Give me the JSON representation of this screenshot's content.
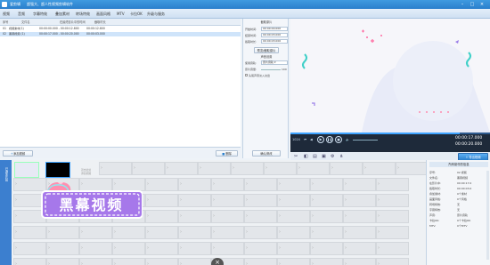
{
  "titlebar": {
    "app_name": "爱剪辑",
    "subtitle": "超强大、超人性视频剪辑软件"
  },
  "menu": [
    "视频",
    "音频",
    "字幕特效",
    "叠加素材",
    "转场特效",
    "画面风格",
    "MTV",
    "卡拉OK",
    "升级与服务"
  ],
  "table": {
    "headers": [
      "序号",
      "文件名",
      "在最终影片中的时间",
      "截取时长"
    ],
    "rows": [
      {
        "idx": "01",
        "name": "视频素材(1)",
        "time": "00:00:00.000 - 00:00:12.800",
        "dur": "00:00:12.800"
      },
      {
        "idx": "02",
        "name": "黑幕视频 (1)",
        "time": "00:00:17.000 - 00:00:20.000",
        "dur": "00:00:03.000"
      }
    ]
  },
  "left_footer": {
    "add_video": "添加视频",
    "delete": "删除"
  },
  "side": {
    "clip_section": "截取原片",
    "start_label": "开始时间:",
    "start_val": "00:00:00.000",
    "end_label": "结束时间:",
    "end_val": "00:00:03.000",
    "dur_label": "截取时长:",
    "dur_val": "00:00:03.000",
    "preview_btn": "预览/截取原片",
    "audio_section": "声音设置",
    "track_label": "使用音轨:",
    "track_val": "原片音轨",
    "volume_label": "原片音量:",
    "volume_val": "100",
    "sync_label": "头尾声音淡入淡出",
    "confirm": "确认修改"
  },
  "player": {
    "frame": "1024",
    "current": "00:00:17.000",
    "total": "00:00:20.000"
  },
  "export_btn": "导出视频",
  "tracks": {
    "side_label": "已添加片段",
    "clip1": "视频素材(1)",
    "clip2": "黑幕视频 (1)",
    "hint1": "双击此处",
    "hint2": "添加视频"
  },
  "rightpanel": {
    "title": "所有制作的信息",
    "rows": [
      {
        "k": "序号:",
        "v": "02 视频"
      },
      {
        "k": "文件名:",
        "v": "黑幕视频"
      },
      {
        "k": "在影片中:",
        "v": "00:00:17.0"
      },
      {
        "k": "截取时长:",
        "v": "00:00:03.0"
      },
      {
        "k": "叠加素材:",
        "v": "0个素材"
      },
      {
        "k": "画面风格:",
        "v": "0个风格"
      },
      {
        "k": "转场特效:",
        "v": "无"
      },
      {
        "k": "字幕特效:",
        "v": "无"
      },
      {
        "k": "声音:",
        "v": "原片音轨"
      },
      {
        "k": "卡拉OK:",
        "v": "0个卡拉OK"
      },
      {
        "k": "MTV:",
        "v": "0个MTV"
      }
    ]
  },
  "overlay": {
    "text": "黑幕视频"
  },
  "colors": {
    "accent": "#2a7fcc",
    "overlay": "#a678ea",
    "hat": "#ff8fb0"
  }
}
